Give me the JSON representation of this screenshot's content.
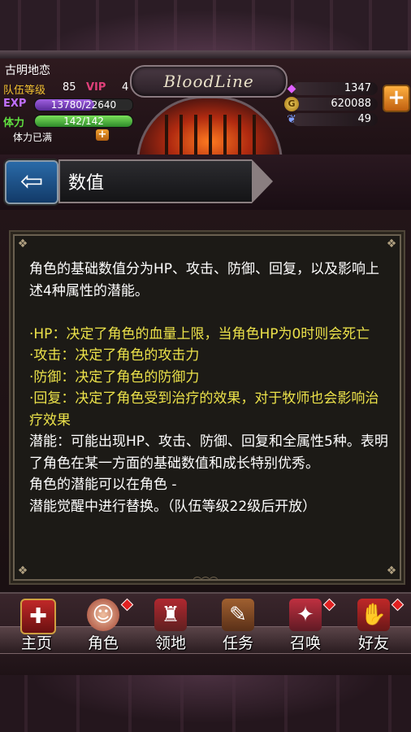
{
  "header": {
    "player_name": "古明地恋",
    "team_level_label": "队伍等级",
    "team_level": "85",
    "vip_label": "VIP",
    "vip_level": "4",
    "exp_label": "EXP",
    "exp_text": "13780/22640",
    "exp_progress": 0.61,
    "stamina_label": "体力",
    "stamina_text": "142/142",
    "stamina_progress": 1.0,
    "stamina_status": "体力已满",
    "logo_text": "BloodLine",
    "currencies": [
      {
        "icon": "gem-icon",
        "value": "1347"
      },
      {
        "icon": "gold-coin-icon",
        "value": "620088"
      },
      {
        "icon": "wing-icon",
        "value": "49"
      }
    ],
    "plus_symbol": "+"
  },
  "title_bar": {
    "back_arrow": "⇦",
    "title": "数值"
  },
  "content": {
    "paragraphs": [
      {
        "text": "角色的基础数值分为HP、攻击、防御、回复，以及影响上述4种属性的潜能。",
        "style": "white"
      },
      {
        "text": "",
        "style": "gap"
      },
      {
        "text": "·HP：决定了角色的血量上限，当角色HP为0时则会死亡",
        "style": "yellow"
      },
      {
        "text": "·攻击：决定了角色的攻击力",
        "style": "yellow"
      },
      {
        "text": "·防御：决定了角色的防御力",
        "style": "yellow"
      },
      {
        "text": "·回复：决定了角色受到治疗的效果，对于牧师也会影响治疗效果",
        "style": "yellow"
      },
      {
        "text": "潜能：可能出现HP、攻击、防御、回复和全属性5种。表明了角色在某一方面的基础数值和成长特别优秀。",
        "style": "white"
      },
      {
        "text": "角色的潜能可以在角色 -",
        "style": "white"
      },
      {
        "text": "潜能觉醒中进行替换。（队伍等级22级后开放）",
        "style": "white"
      }
    ],
    "accent_yellow": "#ece24a"
  },
  "nav": {
    "items": [
      {
        "label": "主页",
        "icon": "home-icon",
        "glyph": "✚",
        "badge": false
      },
      {
        "label": "角色",
        "icon": "character-icon",
        "glyph": "☺",
        "badge": true
      },
      {
        "label": "领地",
        "icon": "castle-icon",
        "glyph": "♜",
        "badge": false
      },
      {
        "label": "任务",
        "icon": "quest-book-icon",
        "glyph": "✎",
        "badge": false
      },
      {
        "label": "召唤",
        "icon": "summon-cards-icon",
        "glyph": "✦",
        "badge": true
      },
      {
        "label": "好友",
        "icon": "handshake-icon",
        "glyph": "✋",
        "badge": true
      }
    ]
  }
}
